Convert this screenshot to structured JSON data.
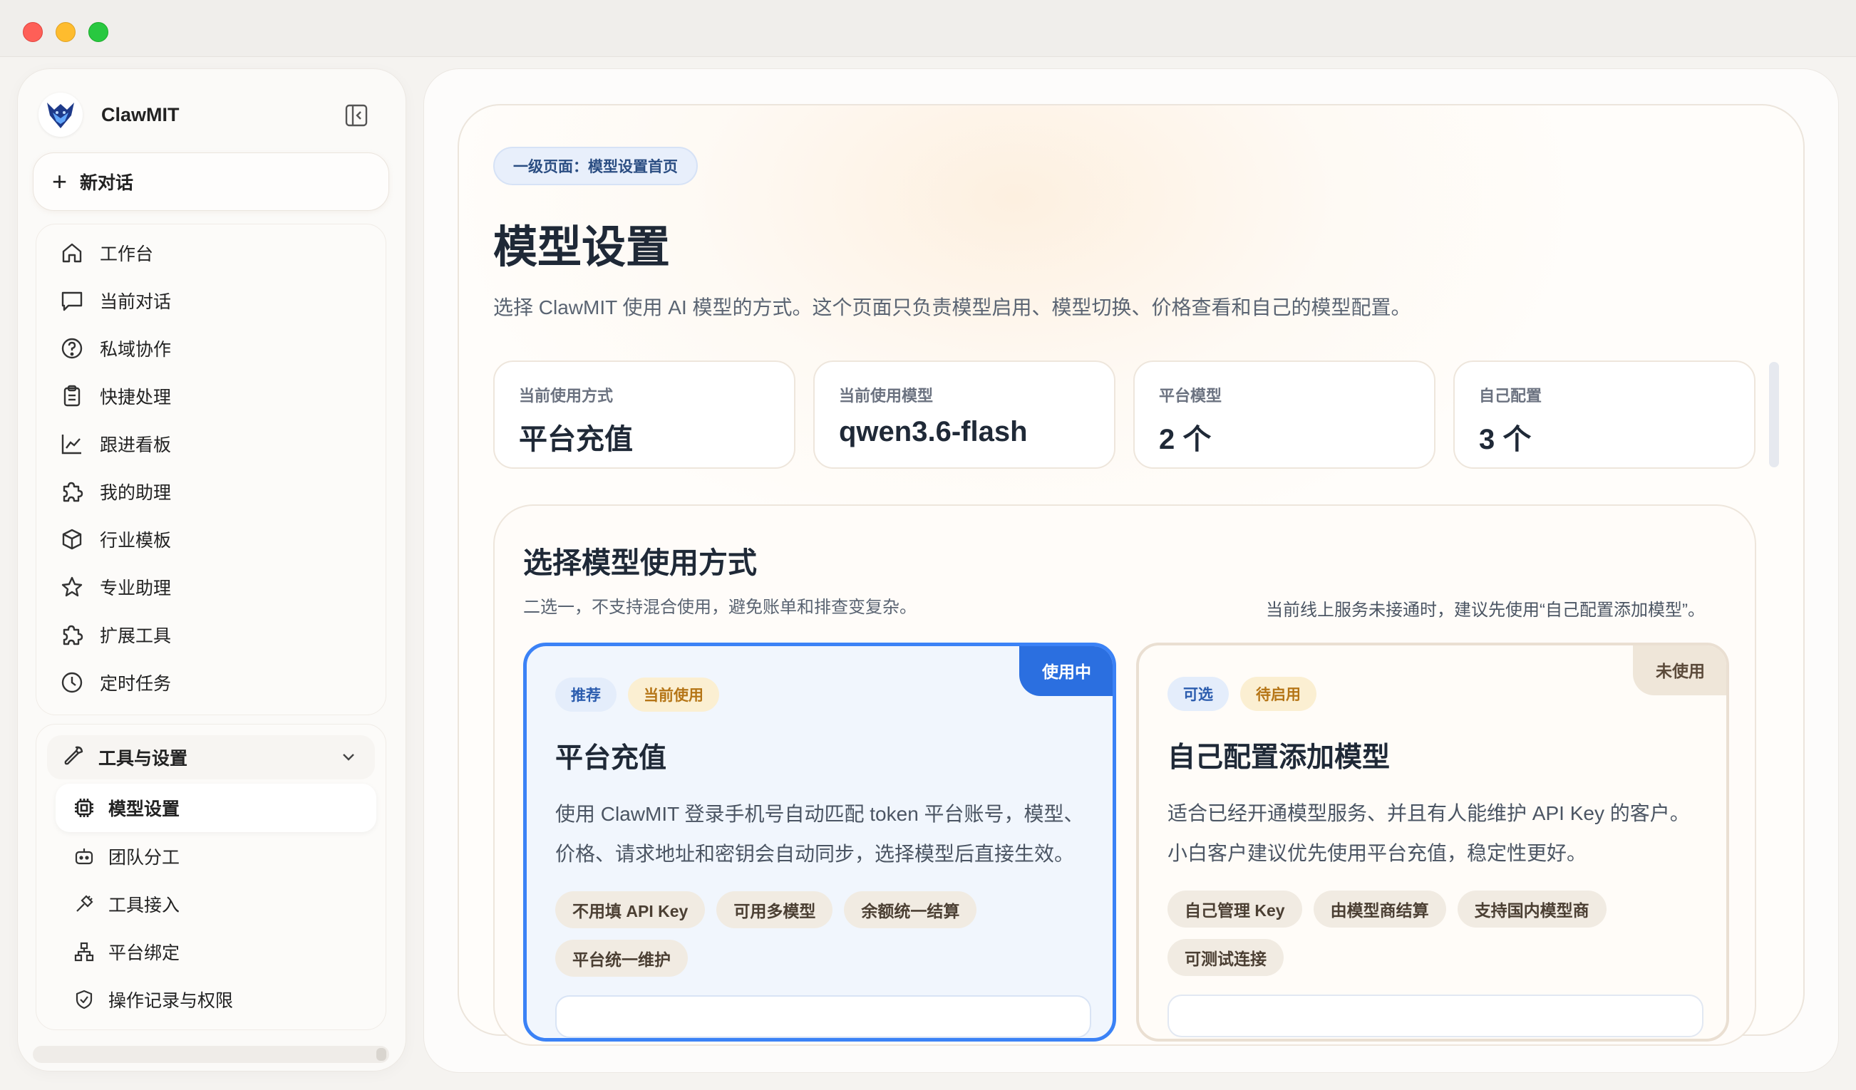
{
  "app": {
    "name": "ClawMIT"
  },
  "sidebar": {
    "new_chat": "新对话",
    "items": [
      {
        "label": "工作台",
        "icon": "home-icon"
      },
      {
        "label": "当前对话",
        "icon": "chat-icon"
      },
      {
        "label": "私域协作",
        "icon": "help-circle-icon"
      },
      {
        "label": "快捷处理",
        "icon": "clipboard-icon"
      },
      {
        "label": "跟进看板",
        "icon": "chart-line-icon"
      },
      {
        "label": "我的助理",
        "icon": "puzzle-icon"
      },
      {
        "label": "行业模板",
        "icon": "box-icon"
      },
      {
        "label": "专业助理",
        "icon": "star-icon"
      },
      {
        "label": "扩展工具",
        "icon": "puzzle-icon"
      },
      {
        "label": "定时任务",
        "icon": "clock-icon"
      }
    ],
    "tools": {
      "label": "工具与设置",
      "items": [
        {
          "label": "模型设置",
          "icon": "chip-icon",
          "active": true
        },
        {
          "label": "团队分工",
          "icon": "bot-icon"
        },
        {
          "label": "工具接入",
          "icon": "plug-icon"
        },
        {
          "label": "平台绑定",
          "icon": "network-icon"
        },
        {
          "label": "操作记录与权限",
          "icon": "shield-icon"
        }
      ]
    }
  },
  "page": {
    "tag": "一级页面：模型设置首页",
    "title": "模型设置",
    "desc": "选择 ClawMIT 使用 AI 模型的方式。这个页面只负责模型启用、模型切换、价格查看和自己的模型配置。",
    "stats": [
      {
        "label": "当前使用方式",
        "value": "平台充值"
      },
      {
        "label": "当前使用模型",
        "value": "qwen3.6-flash"
      },
      {
        "label": "平台模型",
        "value": "2 个"
      },
      {
        "label": "自己配置",
        "value": "3 个"
      }
    ]
  },
  "section": {
    "title": "选择模型使用方式",
    "subtitle": "二选一，不支持混合使用，避免账单和排查变复杂。",
    "note": "当前线上服务未接通时，建议先使用“自己配置添加模型”。",
    "cards": [
      {
        "status": "使用中",
        "badges": [
          "推荐",
          "当前使用"
        ],
        "title": "平台充值",
        "desc": "使用 ClawMIT 登录手机号自动匹配 token 平台账号，模型、价格、请求地址和密钥会自动同步，选择模型后直接生效。",
        "chips": [
          "不用填 API Key",
          "可用多模型",
          "余额统一结算",
          "平台统一维护"
        ]
      },
      {
        "status": "未使用",
        "badges": [
          "可选",
          "待启用"
        ],
        "title": "自己配置添加模型",
        "desc": "适合已经开通模型服务、并且有人能维护 API Key 的客户。小白客户建议优先使用平台充值，稳定性更好。",
        "chips": [
          "自己管理 Key",
          "由模型商结算",
          "支持国内模型商",
          "可测试连接"
        ]
      }
    ]
  },
  "colors": {
    "accent": "#3b82f6",
    "active_corner": "#2b6fe0",
    "close": "#fe5f57",
    "minimize": "#febc2e",
    "zoom": "#28c840"
  }
}
